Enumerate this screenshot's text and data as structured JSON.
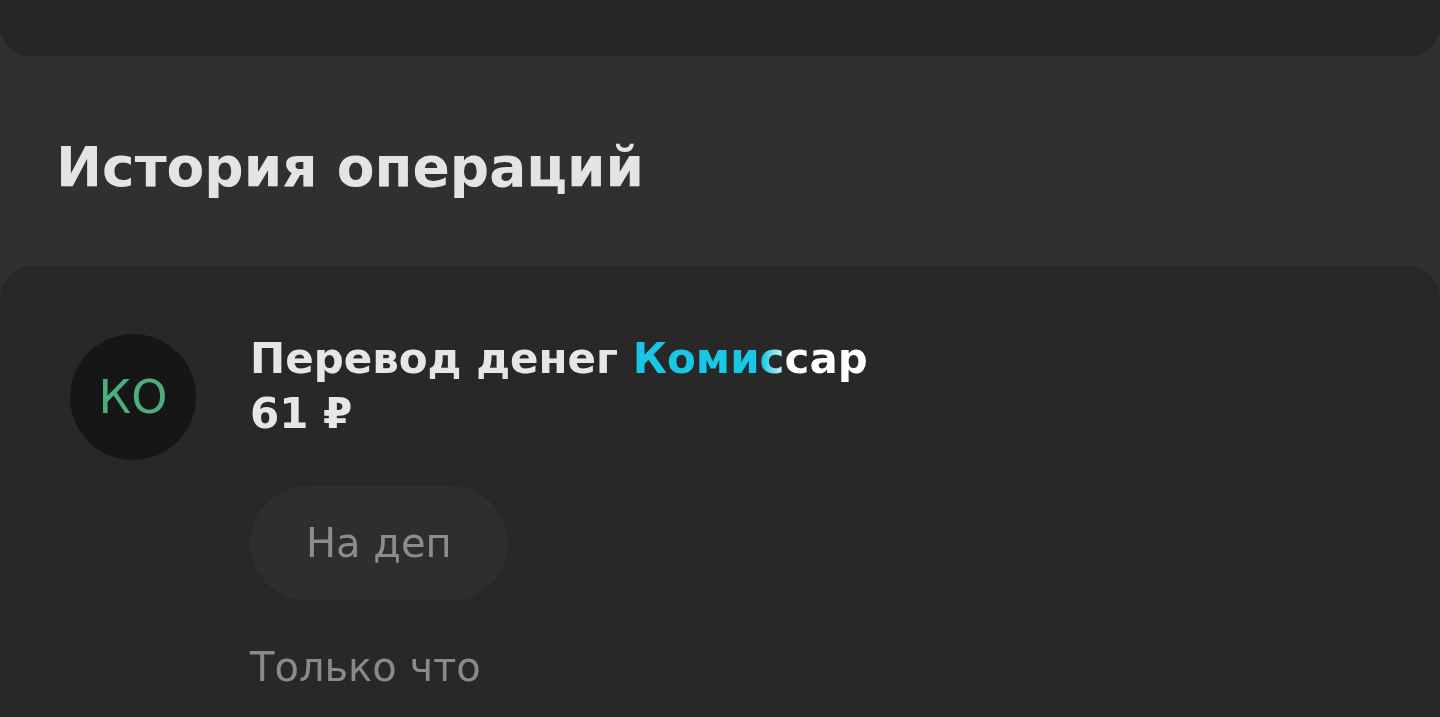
{
  "section_title": "История операций",
  "operations": [
    {
      "initials": "КО",
      "title": "Перевод денег",
      "recipient": "Комиссар",
      "amount": "61 ₽",
      "message": "На деп",
      "time": "Только что"
    }
  ]
}
